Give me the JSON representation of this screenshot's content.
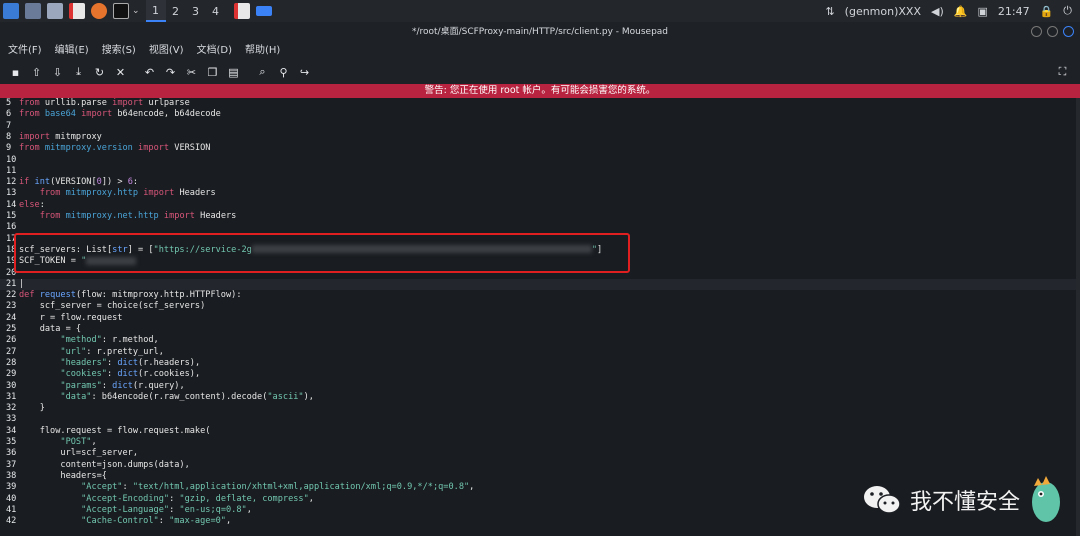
{
  "taskbar": {
    "workspaces": [
      "1",
      "2",
      "3",
      "4"
    ],
    "user": "(genmon)XXX",
    "clock": "21:47"
  },
  "window": {
    "title": "*/root/桌面/SCFProxy-main/HTTP/src/client.py - Mousepad"
  },
  "menu": [
    "文件(F)",
    "编辑(E)",
    "搜索(S)",
    "视图(V)",
    "文档(D)",
    "帮助(H)"
  ],
  "warning": "警告: 您正在使用 root 帐户。有可能会损害您的系统。",
  "watermark": "我不懂安全",
  "colors": {
    "warning_bg": "#b8233f",
    "highlight_box": "#e02020",
    "editor_bg": "#191c20"
  }
}
